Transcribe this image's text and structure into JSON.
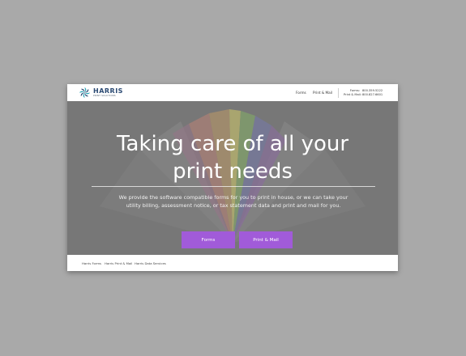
{
  "header": {
    "logo": {
      "word": "HARRIS",
      "sub": "PRINT SOLUTIONS"
    },
    "nav": [
      {
        "label": "Forms"
      },
      {
        "label": "Print & Mail"
      }
    ],
    "phones": [
      {
        "label": "Forms:",
        "number": "800.359.5222"
      },
      {
        "label": "Print & Mail:",
        "number": "800.827.6601"
      }
    ]
  },
  "hero": {
    "headline_line1": "Taking care of all your",
    "headline_line2": "print needs",
    "subtext": "We provide the software compatible forms for you to print in house, or we can take your utility billing, assessment notice, or tax statement data and print and mail for you.",
    "buttons": [
      {
        "label": "Forms"
      },
      {
        "label": "Print & Mail"
      }
    ]
  },
  "footer": {
    "links": [
      {
        "label": "Harris Forms"
      },
      {
        "label": "Harris Print & Mail"
      },
      {
        "label": "Harris Data Services"
      }
    ]
  },
  "colors": {
    "page_bg": "#a9a9a9",
    "accent_button": "#a15bd9",
    "logo_blue": "#2b4a73",
    "logo_teal": "#2aa6b8"
  },
  "icons": {
    "logo_mark": "harris-pinwheel-logo-icon"
  }
}
